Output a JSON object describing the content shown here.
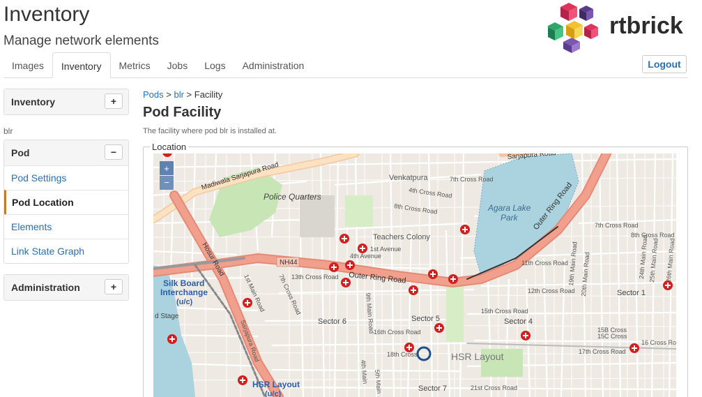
{
  "header": {
    "title": "Inventory",
    "subtitle": "Manage network elements",
    "logo_text": "rtbrick"
  },
  "tabs": [
    {
      "label": "Images"
    },
    {
      "label": "Inventory"
    },
    {
      "label": "Metrics"
    },
    {
      "label": "Jobs"
    },
    {
      "label": "Logs"
    },
    {
      "label": "Administration"
    }
  ],
  "logout_label": "Logout",
  "sidebar": {
    "inventory_label": "Inventory",
    "inventory_toggle": "+",
    "current_pod": "blr",
    "pod_label": "Pod",
    "pod_toggle": "−",
    "items": [
      {
        "label": "Pod Settings"
      },
      {
        "label": "Pod Location"
      },
      {
        "label": "Elements"
      },
      {
        "label": "Link State Graph"
      }
    ],
    "admin_label": "Administration",
    "admin_toggle": "+"
  },
  "breadcrumb": {
    "pods": "Pods",
    "sep1": " > ",
    "pod": "blr",
    "sep2": " > ",
    "current": "Facility"
  },
  "main": {
    "title": "Pod Facility",
    "description": "The facility where pod blr is installed at.",
    "fieldset_label": "Location"
  },
  "map": {
    "zoom_in": "+",
    "zoom_out": "−",
    "labels": {
      "police_quarters": "Police Quarters",
      "agara_lake": "Agara Lake",
      "park": "Park",
      "venkatpura": "Venkatpura",
      "teachers_colony": "Teachers Colony",
      "silk_board": "Silk Board",
      "interchange": "Interchange",
      "uc1": "(u/c)",
      "hsr_layout_station": "HSR Layout",
      "uc2": "(u/c)",
      "hsr_layout": "HSR Layout",
      "sector6": "Sector 6",
      "sector5": "Sector 5",
      "sector4": "Sector 4",
      "sector7": "Sector 7",
      "sector1": "Sector 1",
      "nh44": "NH44",
      "outer_ring_road": "Outer Ring Road",
      "outer_ring_road_v": "Outer Ring Road",
      "madiwala_road": "Madiwala Sarjapura Road",
      "sarjapura_road": "Sarjapura Road",
      "hosur_road": "Hosur Road",
      "stage": "d Stage",
      "13th_cross": "13th Cross Road",
      "4th_cross": "4th Cross Road",
      "7th_cross_top": "7th Cross Road",
      "8th_cross": "8th Cross Road",
      "1st_avenue": "1st Avenue",
      "4th_avenue": "4th Avenue",
      "11th_cross": "11th Cross Road",
      "12th_cross": "12th Cross Road",
      "15th_cross": "15th Cross Road",
      "16th_cross": "16th Cross Road",
      "17th_cross": "17th Cross Road",
      "18th_cross": "18th Cross",
      "21st_cross": "21st Cross Road",
      "7th_cross_right": "7th Cross Road",
      "8th_cross_right": "8th Cross Road",
      "16th_cross_right": "16 Cross Road",
      "15b_cross": "15B Cross",
      "15c_cross": "15C Cross",
      "1st_main": "1st Main Road",
      "19th_main": "19th Main Road",
      "20th_main": "20th Main Road",
      "24th_main": "24th Main Road",
      "25th_main": "25th Main Road",
      "26th_main": "26th Main Road",
      "9th_main": "9th Main Road",
      "7th_cross_road": "7th Cross Road",
      "5th_main": "5th Main",
      "4th_main": "4th Main",
      "sarjapura_road_2": "Sarjapura Road"
    }
  },
  "colors": {
    "link": "#2a6fb0",
    "active_accent": "#c97a2d",
    "major_road": "#f0a08d",
    "water": "#aad3df",
    "park": "#c8e6b5",
    "marker": "#d21f1f"
  }
}
